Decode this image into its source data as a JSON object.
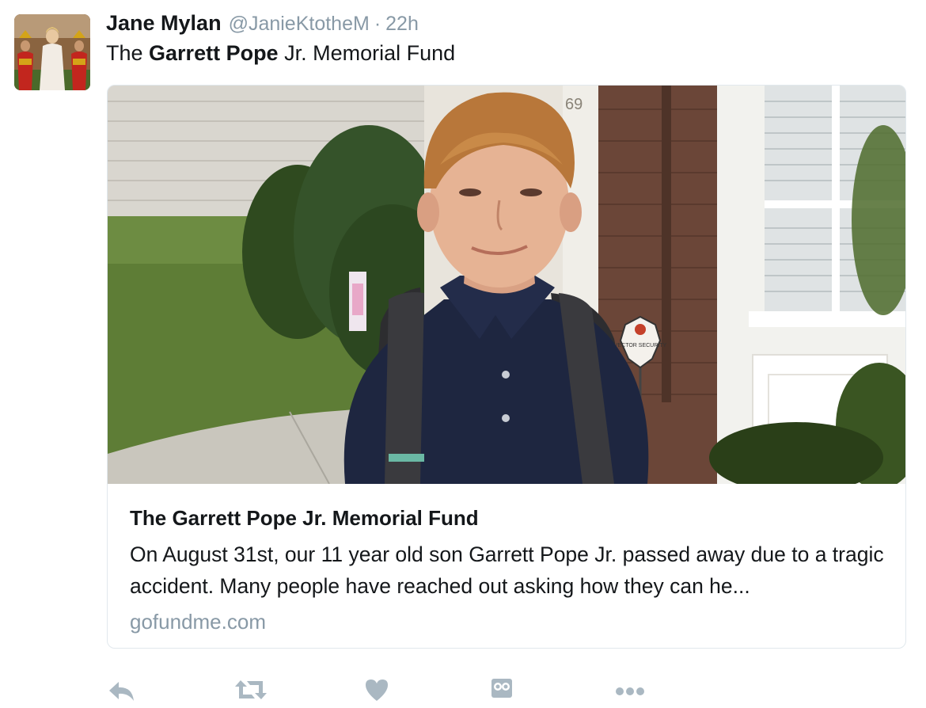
{
  "tweet": {
    "display_name": "Jane Mylan",
    "handle": "@JanieKtotheM",
    "separator": "·",
    "time": "22h",
    "text_before": "The ",
    "text_bold": "Garrett Pope",
    "text_after": " Jr. Memorial Fund"
  },
  "card": {
    "title": "The Garrett Pope Jr. Memorial Fund",
    "description": "On August 31st, our 11 year old son Garrett Pope Jr. passed away due to a tragic accident.  Many people have reached out asking how they can he...",
    "domain": "gofundme.com",
    "image_sign_text": "VECTOR SECURITY",
    "image_house_number": "69"
  },
  "actions": {
    "icons": [
      "reply-icon",
      "retweet-icon",
      "like-icon",
      "dm-icon",
      "more-icon"
    ]
  },
  "colors": {
    "text_primary": "#14171a",
    "text_secondary": "#8899a6",
    "action_icon": "#aab8c2",
    "card_border": "#e1e8ed"
  }
}
